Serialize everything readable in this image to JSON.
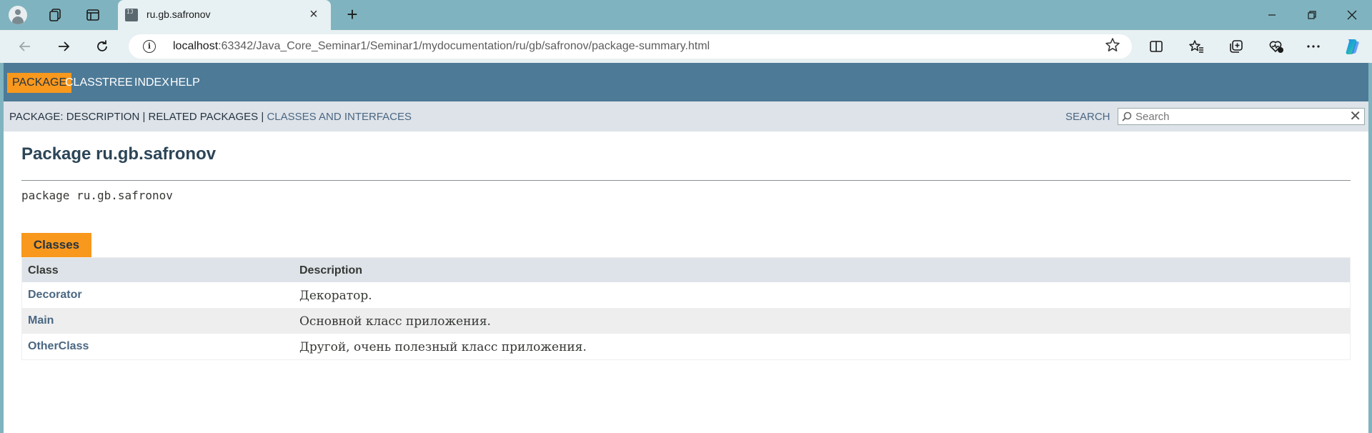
{
  "browser": {
    "tab_title": "ru.gb.safronov",
    "tab_favicon_text": "IJ",
    "url_host": "localhost",
    "url_rest": ":63342/Java_Core_Seminar1/Seminar1/mydocumentation/ru/gb/safronov/package-summary.html"
  },
  "topnav": {
    "items": [
      "PACKAGE",
      "CLASS",
      "TREE",
      "INDEX",
      "HELP"
    ]
  },
  "subnav": {
    "prefix": "PACKAGE:",
    "description": "DESCRIPTION",
    "sep1": "|",
    "related": "RELATED PACKAGES",
    "sep2": "|",
    "classes_link": "CLASSES AND INTERFACES",
    "search_label": "SEARCH",
    "search_placeholder": "Search"
  },
  "page": {
    "title": "Package ru.gb.safronov",
    "declaration": "package ru.gb.safronov"
  },
  "classes_table": {
    "caption": "Classes",
    "headers": [
      "Class",
      "Description"
    ],
    "rows": [
      {
        "name": "Decorator",
        "description": "Декоратор."
      },
      {
        "name": "Main",
        "description": "Основной класс приложения."
      },
      {
        "name": "OtherClass",
        "description": "Другой, очень полезный класс приложения."
      }
    ]
  },
  "icons": [
    "avatar-icon",
    "workspaces-icon",
    "tab-actions-icon",
    "close-icon",
    "new-tab-icon",
    "minimize-icon",
    "maximize-icon",
    "window-close-icon",
    "back-icon",
    "forward-icon",
    "reload-icon",
    "info-icon",
    "favorite-star-icon",
    "split-screen-icon",
    "favorites-icon",
    "collections-icon",
    "browser-essentials-icon",
    "more-icon",
    "copilot-icon",
    "search-icon",
    "clear-icon"
  ]
}
